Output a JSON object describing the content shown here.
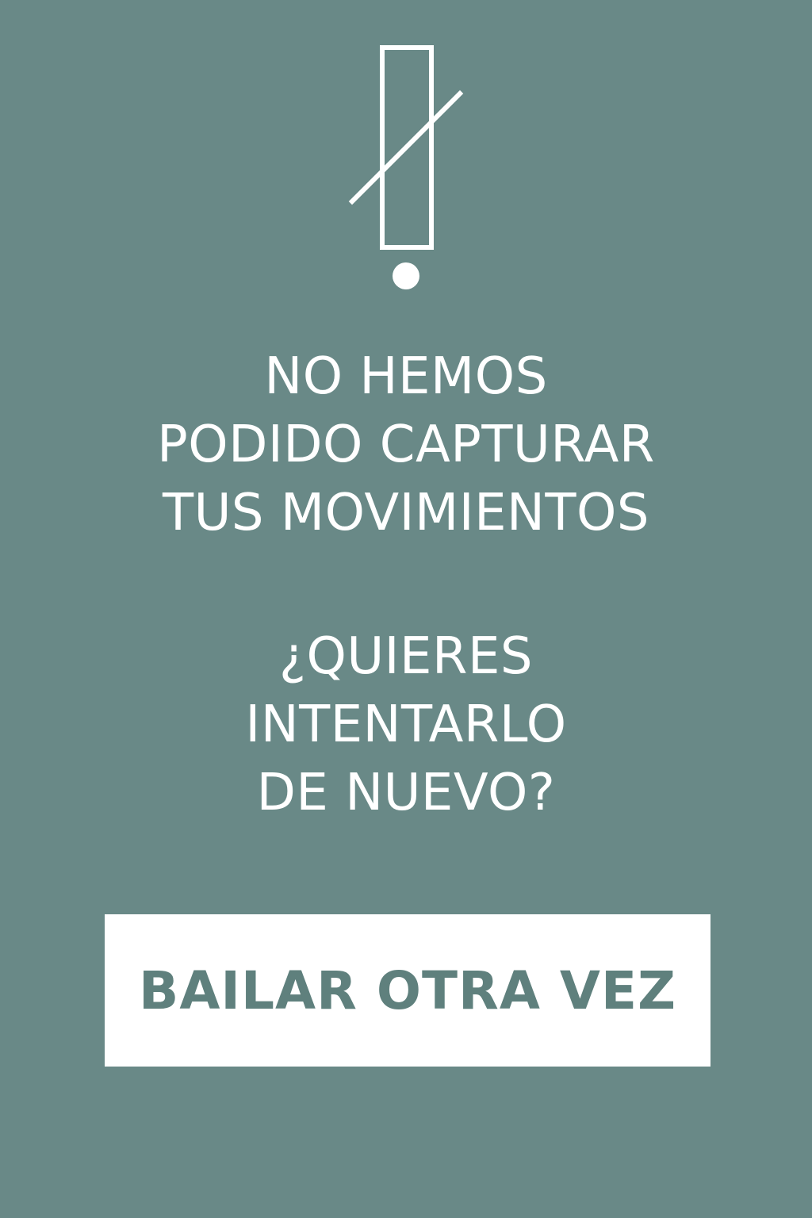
{
  "colors": {
    "background": "#698987",
    "foreground": "#FFFFFF",
    "button_text": "#5F807D"
  },
  "icon": {
    "name": "no-motion-alert-icon"
  },
  "message": {
    "primary_lines": [
      "NO HEMOS",
      "PODIDO CAPTURAR",
      "TUS MOVIMIENTOS"
    ],
    "secondary_lines": [
      "¿QUIERES",
      "INTENTARLO",
      "DE NUEVO?"
    ]
  },
  "action": {
    "button_label": "BAILAR OTRA VEZ"
  }
}
